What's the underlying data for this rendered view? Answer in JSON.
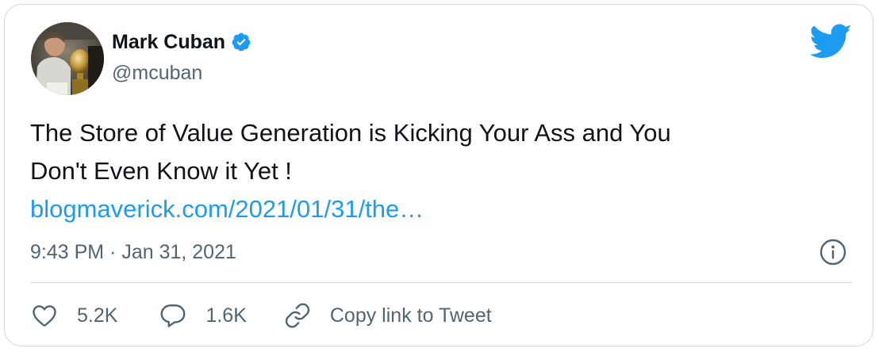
{
  "author": {
    "display_name": "Mark Cuban",
    "handle": "@mcuban",
    "verified": true
  },
  "tweet": {
    "text_lines": [
      "The Store of Value Generation is Kicking Your Ass and You",
      "Don't Even Know it Yet !"
    ],
    "link_text": "blogmaverick.com/2021/01/31/the…",
    "timestamp": "9:43 PM · Jan 31, 2021"
  },
  "actions": {
    "likes": "5.2K",
    "replies": "1.6K",
    "copy_link_label": "Copy link to Tweet"
  },
  "icons": {
    "brand": "twitter-bird-icon",
    "verified": "verified-badge-icon",
    "info": "info-icon",
    "like": "heart-icon",
    "reply": "reply-bubble-icon",
    "copy_link": "link-icon"
  },
  "colors": {
    "accent": "#1d9bf0",
    "text_primary": "#0f1419",
    "text_secondary": "#536471",
    "border": "#cfd9de"
  }
}
